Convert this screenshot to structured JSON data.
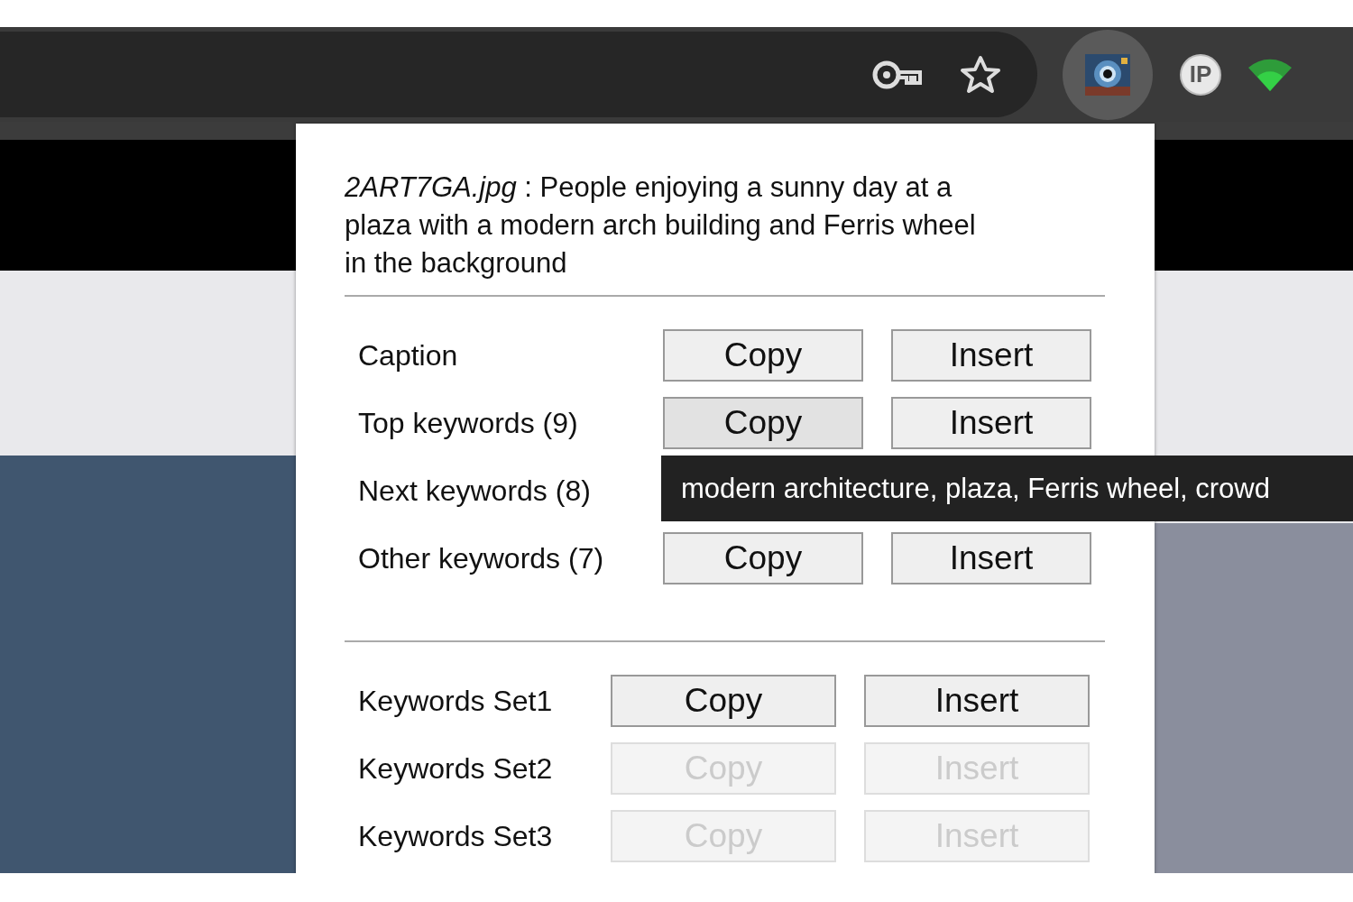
{
  "toolbar": {
    "icons": [
      {
        "kind": "key",
        "selected": false
      },
      {
        "kind": "star",
        "selected": false
      },
      {
        "kind": "camera",
        "selected": true
      },
      {
        "kind": "ip",
        "label": "IP",
        "selected": false
      },
      {
        "kind": "wifi",
        "selected": false
      }
    ]
  },
  "popup": {
    "caption": "*2ART7GA.jpg* : People enjoying a sunny day at a plaza with a modern arch building and Ferris wheel in the background",
    "sections": [
      {
        "rows": [
          {
            "label": "Caption",
            "buttons": [
              {
                "label": "Copy",
                "disabled": false,
                "hovered": false
              },
              {
                "label": "Insert",
                "disabled": false,
                "hovered": false
              }
            ]
          },
          {
            "label": "Top keywords (9)",
            "buttons": [
              {
                "label": "Copy",
                "disabled": false,
                "hovered": true
              },
              {
                "label": "Insert",
                "disabled": false,
                "hovered": false
              }
            ]
          },
          {
            "label": "Next keywords (8)"
          },
          {
            "label": "Other keywords (7)",
            "buttons": [
              {
                "label": "Copy",
                "disabled": false,
                "hovered": false
              },
              {
                "label": "Insert",
                "disabled": false,
                "hovered": false
              }
            ]
          }
        ]
      },
      {
        "rows": [
          {
            "label": "Keywords Set1",
            "buttons": [
              {
                "label": "Copy",
                "disabled": false,
                "hovered": false
              },
              {
                "label": "Insert",
                "disabled": false,
                "hovered": false
              }
            ]
          },
          {
            "label": "Keywords Set2",
            "buttons": [
              {
                "label": "Copy",
                "disabled": true,
                "hovered": false
              },
              {
                "label": "Insert",
                "disabled": true,
                "hovered": false
              }
            ]
          },
          {
            "label": "Keywords Set3",
            "buttons": [
              {
                "label": "Copy",
                "disabled": true,
                "hovered": false
              },
              {
                "label": "Insert",
                "disabled": true,
                "hovered": false
              }
            ]
          }
        ]
      }
    ]
  },
  "tooltip": {
    "text": "modern architecture, plaza, Ferris wheel, crowd"
  }
}
